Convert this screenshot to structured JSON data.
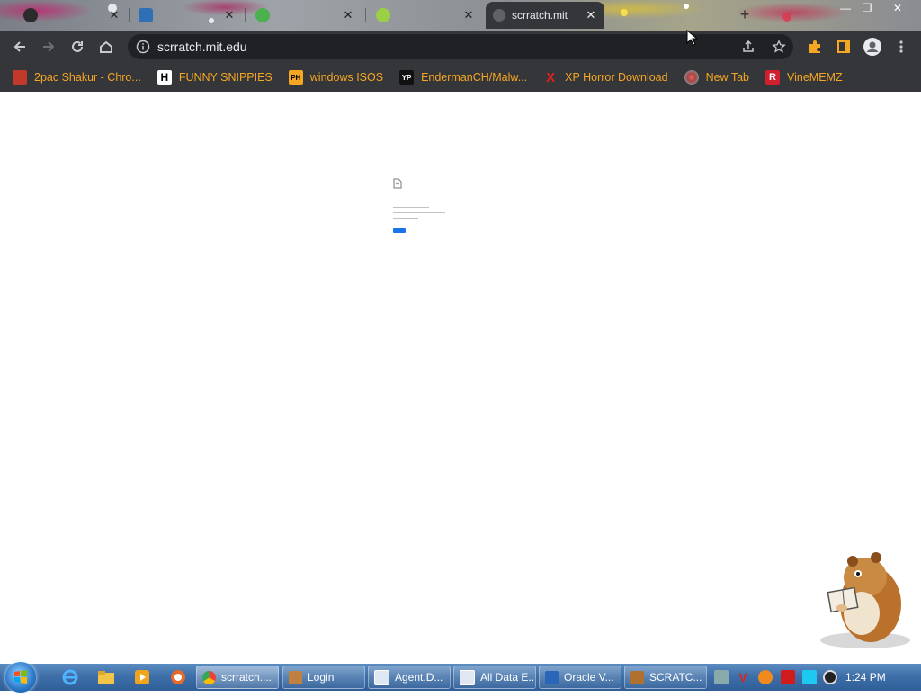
{
  "tabs": [
    {
      "title": "",
      "favicon": "github-icon"
    },
    {
      "title": "",
      "favicon": "download-icon"
    },
    {
      "title": "",
      "favicon": "download-icon"
    },
    {
      "title": "",
      "favicon": "scratch-icon"
    },
    {
      "title": "scrratch.mit",
      "favicon": "page-icon",
      "active": true
    }
  ],
  "toolbar": {
    "url": "scrratch.mit.edu"
  },
  "bookmarks": [
    {
      "label": "2pac Shakur - Chro...",
      "icon": "bookmark-icon"
    },
    {
      "label": "FUNNY SNIPPIES",
      "icon": "H"
    },
    {
      "label": "windows ISOS",
      "icon": "PH"
    },
    {
      "label": "EndermanCH/Malw...",
      "icon": "YP"
    },
    {
      "label": "XP Horror Download",
      "icon": "X"
    },
    {
      "label": "New Tab",
      "icon": "globe-icon"
    },
    {
      "label": "VineMEMZ",
      "icon": "R"
    }
  ],
  "error_page": {
    "heading": "",
    "button_label": "",
    "button_color": "#1a73e8"
  },
  "taskbar": {
    "tasks": [
      {
        "label": "scrratch....",
        "icon": "chrome-icon",
        "active": true
      },
      {
        "label": "Login",
        "icon": "app-icon"
      },
      {
        "label": "Agent.D...",
        "icon": "window-icon"
      },
      {
        "label": "All Data E...",
        "icon": "window-icon"
      },
      {
        "label": "Oracle V...",
        "icon": "virtualbox-icon"
      },
      {
        "label": "SCRATC...",
        "icon": "tool-icon"
      }
    ],
    "clock": "1:24 PM"
  },
  "colors": {
    "chrome_dark": "#35363a",
    "bookmark_text": "#f5a623",
    "taskbar": "#3f6fa8"
  }
}
